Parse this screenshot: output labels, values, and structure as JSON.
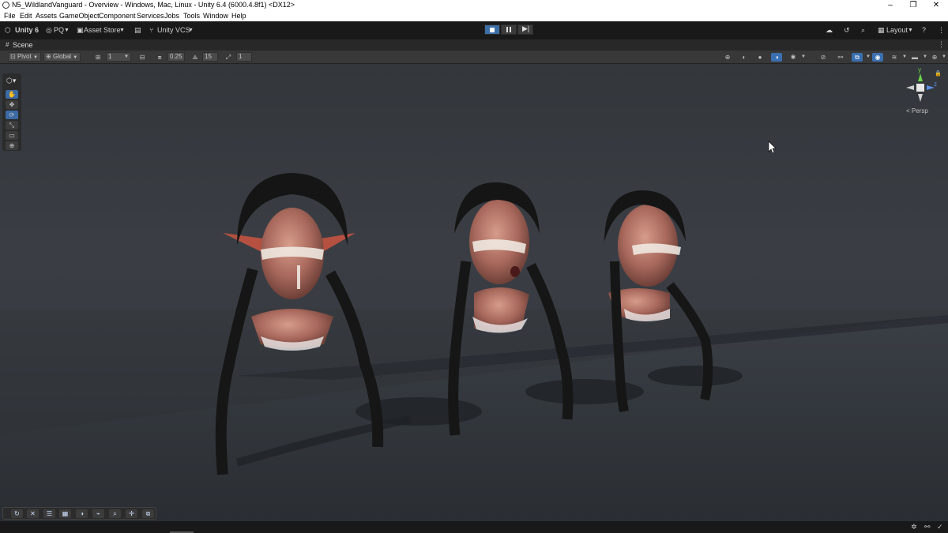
{
  "window": {
    "title": "N5_WildlandVanguard - Overview - Windows, Mac, Linux - Unity 6.4 (6000.4.8f1) <DX12>",
    "minimize": "–",
    "restore": "❐",
    "close": "✕"
  },
  "menu": [
    "File",
    "Edit",
    "Assets",
    "GameObject",
    "Component",
    "Services",
    "Jobs",
    "Tools",
    "Window",
    "Help"
  ],
  "toolbar": {
    "unity": "Unity 6",
    "account": "PQ",
    "asset_store": "Asset Store",
    "vcs": "Unity VCS",
    "layout": "Layout"
  },
  "scene_tab": {
    "label": "Scene"
  },
  "scene_toolbar": {
    "pivot": "Pivot",
    "global": "Global",
    "grid_value": "1",
    "snap_value": "0.25",
    "angle_value": "15",
    "scale_value": "1"
  },
  "gizmo": {
    "y": "y",
    "z": "z",
    "persp": "< Persp"
  },
  "colors": {
    "accent": "#3d6ea8",
    "viewport_bg": "#383c42",
    "floor": "#2e3338"
  }
}
